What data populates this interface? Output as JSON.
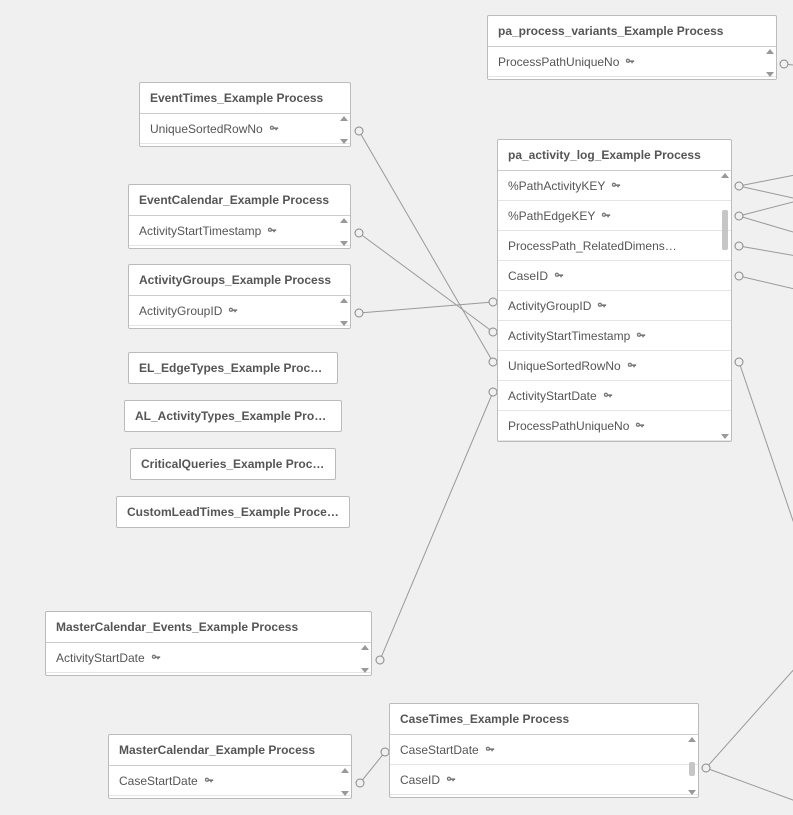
{
  "entities": {
    "pa_process_variants": {
      "title": "pa_process_variants_Example Process",
      "fields": [
        {
          "label": "ProcessPathUniqueNo",
          "key": true
        }
      ]
    },
    "event_times": {
      "title": "EventTimes_Example Process",
      "fields": [
        {
          "label": "UniqueSortedRowNo",
          "key": true
        }
      ]
    },
    "event_calendar": {
      "title": "EventCalendar_Example Process",
      "fields": [
        {
          "label": "ActivityStartTimestamp",
          "key": true
        }
      ]
    },
    "activity_groups": {
      "title": "ActivityGroups_Example Process",
      "fields": [
        {
          "label": "ActivityGroupID",
          "key": true
        }
      ]
    },
    "pa_activity_log": {
      "title": "pa_activity_log_Example Process",
      "fields": [
        {
          "label": "%PathActivityKEY",
          "key": true
        },
        {
          "label": "%PathEdgeKEY",
          "key": true
        },
        {
          "label": "ProcessPath_RelatedDimens…",
          "key": false
        },
        {
          "label": "CaseID",
          "key": true
        },
        {
          "label": "ActivityGroupID",
          "key": true
        },
        {
          "label": "ActivityStartTimestamp",
          "key": true
        },
        {
          "label": "UniqueSortedRowNo",
          "key": true
        },
        {
          "label": "ActivityStartDate",
          "key": true
        },
        {
          "label": "ProcessPathUniqueNo",
          "key": true
        }
      ]
    },
    "el_edge_types": {
      "title": "EL_EdgeTypes_Example Process"
    },
    "al_activity_types": {
      "title": "AL_ActivityTypes_Example Process"
    },
    "critical_queries": {
      "title": "CriticalQueries_Example Process"
    },
    "custom_lead_times": {
      "title": "CustomLeadTimes_Example Process"
    },
    "master_calendar_events": {
      "title": "MasterCalendar_Events_Example Process",
      "fields": [
        {
          "label": "ActivityStartDate",
          "key": true
        }
      ]
    },
    "master_calendar": {
      "title": "MasterCalendar_Example Process",
      "fields": [
        {
          "label": "CaseStartDate",
          "key": true
        }
      ]
    },
    "case_times": {
      "title": "CaseTimes_Example Process",
      "fields": [
        {
          "label": "CaseStartDate",
          "key": true
        },
        {
          "label": "CaseID",
          "key": true
        }
      ]
    }
  }
}
